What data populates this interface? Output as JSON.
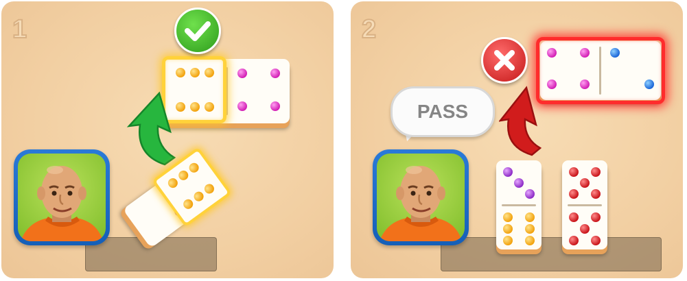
{
  "panel1": {
    "step": "1",
    "result": "valid-move",
    "badge_icon": "check-icon",
    "highlight_color": "#ffd23a"
  },
  "panel2": {
    "step": "2",
    "result": "invalid-move",
    "badge_icon": "cross-icon",
    "speech": "PASS",
    "highlight_color": "#ff2c2c"
  },
  "colors": {
    "check": "#3fb92a",
    "cross": "#e02a2a",
    "arrow_green": "#27b63e",
    "arrow_red": "#d11c1c",
    "avatar_frame": "#1e6fd0"
  }
}
